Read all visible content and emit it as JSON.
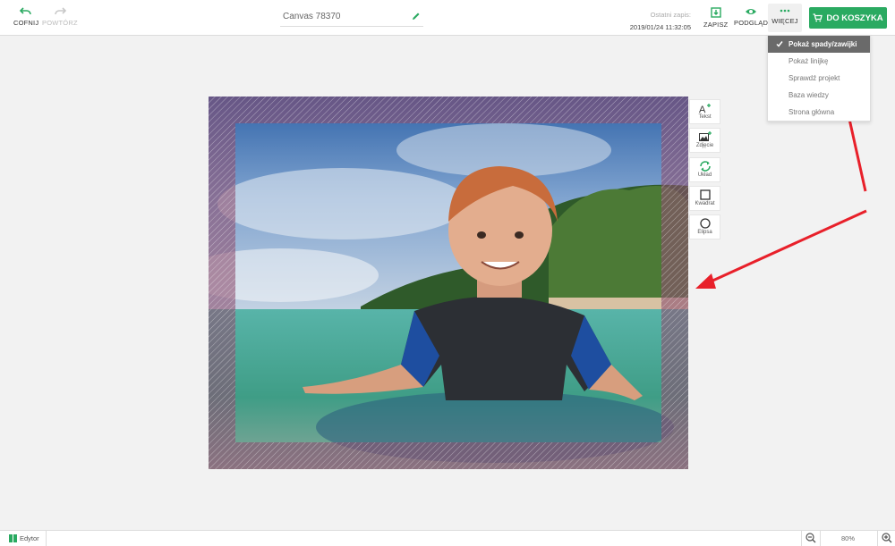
{
  "toolbar": {
    "undo_label": "COFNIJ",
    "redo_label": "POWTÓRZ",
    "project_title": "Canvas 78370",
    "last_save_label": "Ostatni zapis:",
    "last_save_time": "2019/01/24 11:32:05",
    "save_label": "ZAPISZ",
    "preview_label": "PODGLĄD",
    "more_label": "WIĘCEJ",
    "cart_label": "DO KOSZYKA"
  },
  "more_menu": {
    "items": [
      {
        "label": "Pokaż spady/zawijki",
        "checked": true
      },
      {
        "label": "Pokaż linijkę",
        "checked": false
      },
      {
        "label": "Sprawdź projekt",
        "checked": false
      },
      {
        "label": "Baza wiedzy",
        "checked": false
      },
      {
        "label": "Strona główna",
        "checked": false
      }
    ]
  },
  "side_tools": [
    {
      "label": "Tekst",
      "icon": "text-add-icon"
    },
    {
      "label": "Zdjęcie",
      "icon": "image-add-icon"
    },
    {
      "label": "Układ",
      "icon": "layout-refresh-icon"
    },
    {
      "label": "Kwadrat",
      "icon": "square-icon"
    },
    {
      "label": "Elipsa",
      "icon": "ellipse-icon"
    }
  ],
  "bottom": {
    "editor_label": "Edytor",
    "zoom_value": "80%"
  },
  "colors": {
    "accent_green": "#2aaa61",
    "annotation_red": "#e8202a"
  }
}
